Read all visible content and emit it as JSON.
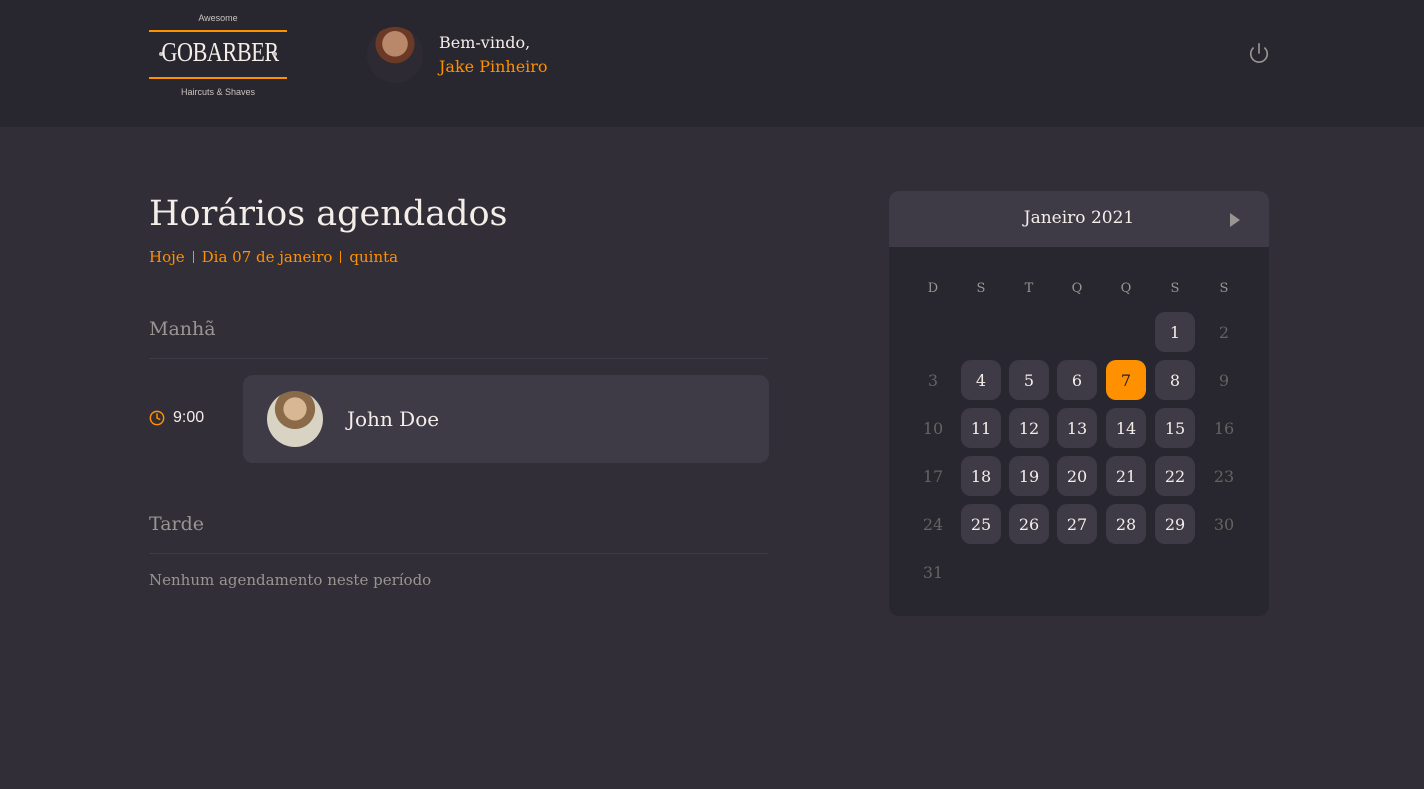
{
  "header": {
    "logo": {
      "top_text": "Awesome",
      "main_text": "GOBARBER",
      "bottom_text": "Haircuts & Shaves"
    },
    "welcome": "Bem-vindo,",
    "user_name": "Jake Pinheiro",
    "logout_icon": "power-icon"
  },
  "schedule": {
    "title": "Horários agendados",
    "subtitle": {
      "today": "Hoje",
      "date": "Dia 07 de janeiro",
      "weekday": "quinta"
    },
    "morning": {
      "title": "Manhã",
      "appointments": [
        {
          "time": "9:00",
          "client": "John Doe"
        }
      ]
    },
    "afternoon": {
      "title": "Tarde",
      "empty_message": "Nenhum agendamento neste período"
    }
  },
  "calendar": {
    "month_label": "Janeiro 2021",
    "weekdays": [
      "D",
      "S",
      "T",
      "Q",
      "Q",
      "S",
      "S"
    ],
    "first_weekday_index": 5,
    "days_in_month": 31,
    "selected_day": 7,
    "unavailable_days": [
      2,
      3,
      9,
      10,
      16,
      17,
      23,
      24,
      30,
      31
    ]
  },
  "colors": {
    "accent": "#ff9000",
    "background": "#312e38",
    "panel": "#28262e",
    "card": "#3e3b47",
    "muted_text": "#999591"
  }
}
